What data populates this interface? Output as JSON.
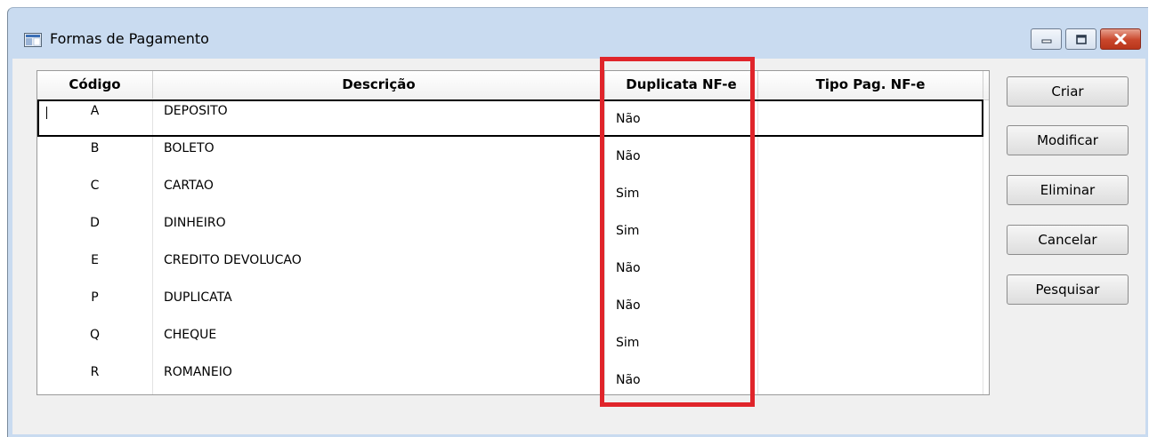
{
  "window": {
    "title": "Formas de Pagamento",
    "icon": "window-app-icon"
  },
  "table": {
    "columns": [
      "Código",
      "Descrição",
      "Duplicata NF-e",
      "Tipo Pag. NF-e"
    ],
    "rows": [
      {
        "code": "A",
        "desc": "DEPOSITO",
        "dup": "Não",
        "tipo": ""
      },
      {
        "code": "B",
        "desc": "BOLETO",
        "dup": "Não",
        "tipo": ""
      },
      {
        "code": "C",
        "desc": "CARTAO",
        "dup": "Sim",
        "tipo": ""
      },
      {
        "code": "D",
        "desc": "DINHEIRO",
        "dup": "Sim",
        "tipo": ""
      },
      {
        "code": "E",
        "desc": "CREDITO DEVOLUCAO",
        "dup": "Não",
        "tipo": ""
      },
      {
        "code": "P",
        "desc": "DUPLICATA",
        "dup": "Não",
        "tipo": ""
      },
      {
        "code": "Q",
        "desc": "CHEQUE",
        "dup": "Sim",
        "tipo": ""
      },
      {
        "code": "R",
        "desc": "ROMANEIO",
        "dup": "Não",
        "tipo": ""
      }
    ]
  },
  "buttons": {
    "criar": "Criar",
    "modificar": "Modificar",
    "eliminar": "Eliminar",
    "cancelar": "Cancelar",
    "pesquisar": "Pesquisar"
  },
  "colors": {
    "highlight": "#e0252b",
    "window_frame": "#c9dbf0",
    "close_button": "#c9462b"
  }
}
